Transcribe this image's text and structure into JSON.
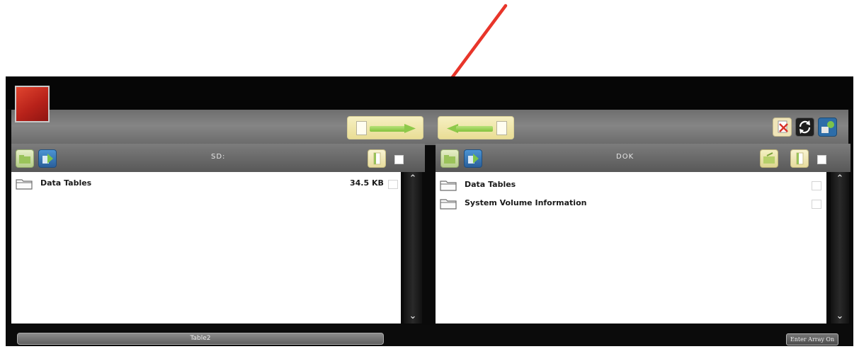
{
  "left_pane": {
    "drive": "SD:",
    "files": [
      {
        "name": "Data Tables",
        "size": "34.5 KB"
      }
    ]
  },
  "right_pane": {
    "drive": "DOK",
    "files": [
      {
        "name": "Data Tables"
      },
      {
        "name": "System Volume Information"
      }
    ]
  },
  "bottom": {
    "table_name": "Table2",
    "enter_button": "Enter Array On"
  },
  "icons": {
    "copy_right": "copy-to-right-icon",
    "copy_left": "copy-to-left-icon",
    "delete": "delete-icon",
    "refresh": "refresh-icon",
    "connect": "connect-icon",
    "up": "up-folder-icon",
    "home": "home-icon",
    "new_folder": "new-folder-icon",
    "properties": "properties-icon"
  },
  "colors": {
    "annotation_arrow": "#e8352a",
    "app_icon": "#c4261c"
  }
}
